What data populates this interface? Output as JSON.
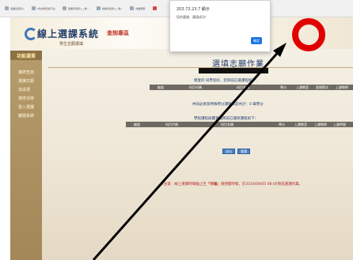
{
  "browser": {
    "tabs": [
      {
        "label": "選課系統登入",
        "icon": "page-icon"
      },
      {
        "label": "E化校務資訊平台",
        "icon": "page-icon"
      },
      {
        "label": "選課系統登入 | 教...",
        "icon": "page-icon"
      },
      {
        "label": "收費系統登入 | 教...",
        "icon": "page-icon"
      },
      {
        "label": "收費服務",
        "icon": "page-icon"
      },
      {
        "label": "",
        "icon": "page-icon"
      }
    ]
  },
  "header": {
    "system_title": "線上選課系統",
    "badge": "查詢專區",
    "subtitle": "學生志願選填"
  },
  "sidebar": {
    "heading": "功能選單",
    "items": [
      "課表查詢",
      "選課志願",
      "加退選",
      "選修清單",
      "登入選課",
      "離開系統"
    ]
  },
  "main": {
    "title": "選填志願作業",
    "info_line": "親愛的 同學您好，您目前已選課程如下：",
    "info_link": "親愛的",
    "table1_headers": [
      "編號",
      "科目代碼",
      "科目名稱",
      "學分",
      "上課教室",
      "星期節次",
      "上課教師"
    ],
    "table2_caption": "共同必修及特殊學分課程目前共計：0 筆學分",
    "table3_caption": "學程課程與體育課目前已選修課程如下：",
    "table3_headers": [
      "編號",
      "科目代碼",
      "科目名稱",
      "學分",
      "上課教室",
      "上課教師",
      "上課時間"
    ],
    "buttons": {
      "confirm": "送出",
      "reset": "重選"
    },
    "notice_prefix": "※注意：線上選課時間截止至",
    "notice_highlight": "「存檔」",
    "notice_suffix": "請把握時間，於2018/09/05 08:00完成選課作業。"
  },
  "popup": {
    "title": "203.72.23.7 顯示",
    "message": "您的選課，選填成功！",
    "ok_label": "確定"
  },
  "annotation": {
    "circle_color": "#e00000",
    "arrow_color": "#000000"
  }
}
